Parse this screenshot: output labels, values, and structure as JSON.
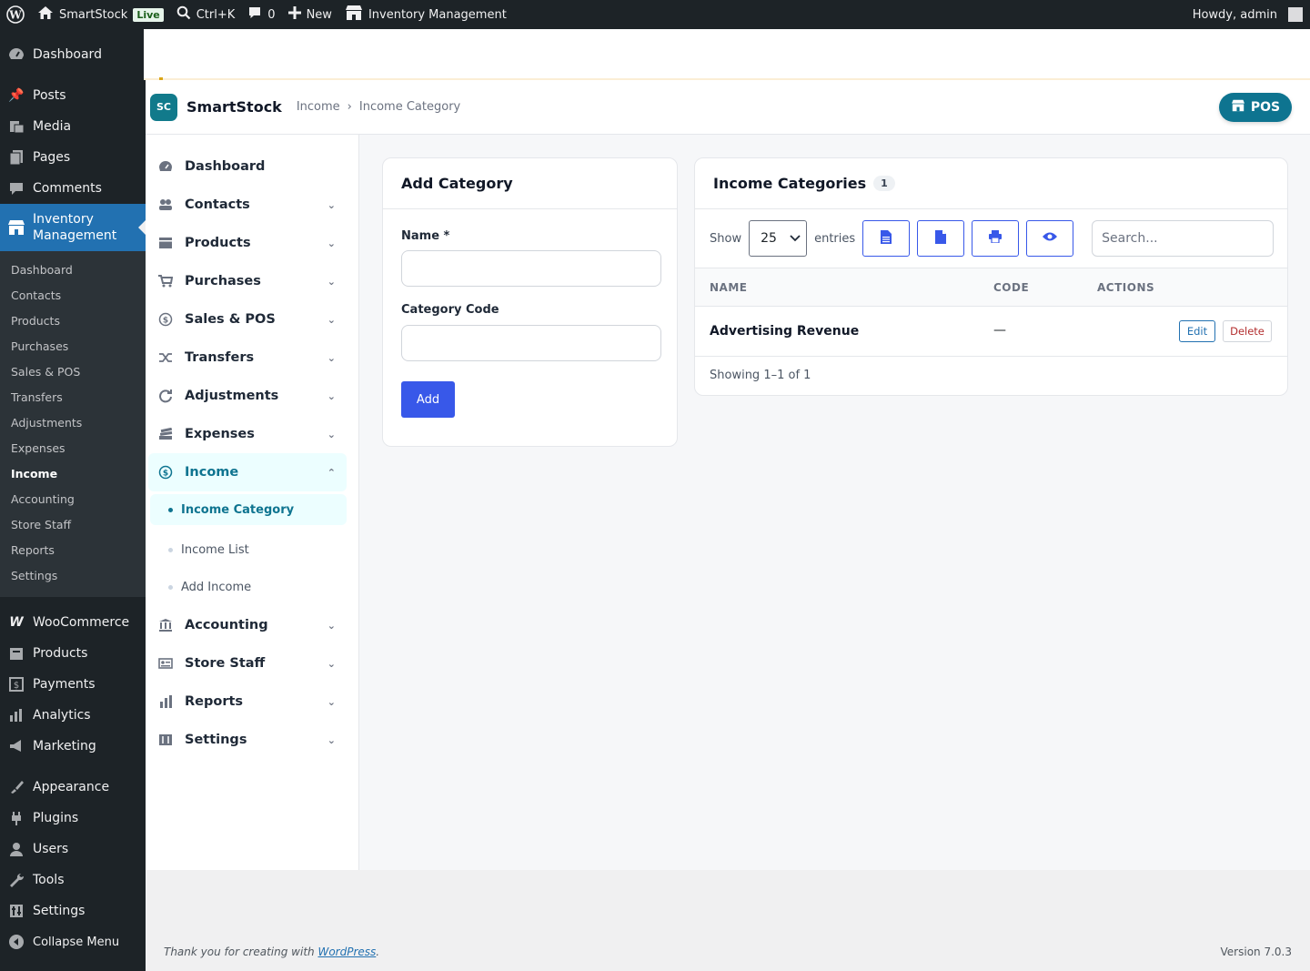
{
  "adminbar": {
    "site_name": "SmartStock",
    "live_badge": "Live",
    "search_shortcut": "Ctrl+K",
    "comments_count": "0",
    "new_label": "New",
    "plugin_label": "Inventory Management",
    "howdy": "Howdy, admin"
  },
  "wpmenu": {
    "top": [
      {
        "label": "Dashboard",
        "icon": "dashboard-icon"
      }
    ],
    "group1": [
      {
        "label": "Posts",
        "icon": "pin-icon"
      },
      {
        "label": "Media",
        "icon": "media-icon"
      },
      {
        "label": "Pages",
        "icon": "pages-icon"
      },
      {
        "label": "Comments",
        "icon": "comment-icon"
      }
    ],
    "active": {
      "label": "Inventory Management",
      "icon": "store-icon"
    },
    "submenu": [
      "Dashboard",
      "Contacts",
      "Products",
      "Purchases",
      "Sales & POS",
      "Transfers",
      "Adjustments",
      "Expenses",
      "Income",
      "Accounting",
      "Store Staff",
      "Reports",
      "Settings"
    ],
    "submenu_current": "Income",
    "group2": [
      {
        "label": "WooCommerce",
        "icon": "woo-icon"
      },
      {
        "label": "Products",
        "icon": "archive-icon"
      },
      {
        "label": "Payments",
        "icon": "payments-icon"
      },
      {
        "label": "Analytics",
        "icon": "chart-bar-icon"
      },
      {
        "label": "Marketing",
        "icon": "megaphone-icon"
      }
    ],
    "group3": [
      {
        "label": "Appearance",
        "icon": "brush-icon"
      },
      {
        "label": "Plugins",
        "icon": "plugin-icon"
      },
      {
        "label": "Users",
        "icon": "user-icon"
      },
      {
        "label": "Tools",
        "icon": "wrench-icon"
      },
      {
        "label": "Settings",
        "icon": "sliders-icon"
      },
      {
        "label": "Collapse Menu",
        "icon": "collapse-icon"
      }
    ]
  },
  "app": {
    "logo_text": "SC",
    "brand": "SmartStock",
    "breadcrumb": [
      "Income",
      "Income Category"
    ],
    "breadcrumb_sep": "›",
    "pos_label": "POS"
  },
  "sidebar": {
    "items": [
      {
        "label": "Dashboard",
        "icon": "gauge-icon",
        "chevron": false
      },
      {
        "label": "Contacts",
        "icon": "users-icon",
        "chevron": true
      },
      {
        "label": "Products",
        "icon": "box-icon",
        "chevron": true
      },
      {
        "label": "Purchases",
        "icon": "cart-icon",
        "chevron": true
      },
      {
        "label": "Sales & POS",
        "icon": "dollar-circle-icon",
        "chevron": true
      },
      {
        "label": "Transfers",
        "icon": "shuffle-icon",
        "chevron": true
      },
      {
        "label": "Adjustments",
        "icon": "refresh-icon",
        "chevron": true
      },
      {
        "label": "Expenses",
        "icon": "money-stack-icon",
        "chevron": true
      }
    ],
    "income": {
      "label": "Income",
      "icon": "dollar-circle-icon"
    },
    "income_sub": [
      "Income Category",
      "Income List",
      "Add Income"
    ],
    "items_after": [
      {
        "label": "Accounting",
        "icon": "bank-icon"
      },
      {
        "label": "Store Staff",
        "icon": "id-card-icon"
      },
      {
        "label": "Reports",
        "icon": "bars-icon"
      },
      {
        "label": "Settings",
        "icon": "settings-icon"
      }
    ]
  },
  "add_category": {
    "title": "Add Category",
    "name_label": "Name *",
    "name_value": "",
    "code_label": "Category Code",
    "code_value": "",
    "add_button": "Add"
  },
  "income_categories": {
    "title": "Income Categories",
    "count": "1",
    "show_label": "Show",
    "page_size": "25",
    "entries_label": "entries",
    "search_placeholder": "Search...",
    "columns": [
      "NAME",
      "CODE",
      "ACTIONS"
    ],
    "rows": [
      {
        "name": "Advertising Revenue",
        "code": "—"
      }
    ],
    "edit_label": "Edit",
    "delete_label": "Delete",
    "showing": "Showing 1–1 of 1"
  },
  "footer": {
    "thanks_prefix": "Thank you for creating with ",
    "thanks_link": "WordPress",
    "thanks_suffix": ".",
    "version": "Version 7.0.3"
  },
  "colors": {
    "wp_dark": "#1d2327",
    "wp_blue": "#2271b1",
    "teal": "#0e7490",
    "primary_button": "#3858e9"
  }
}
